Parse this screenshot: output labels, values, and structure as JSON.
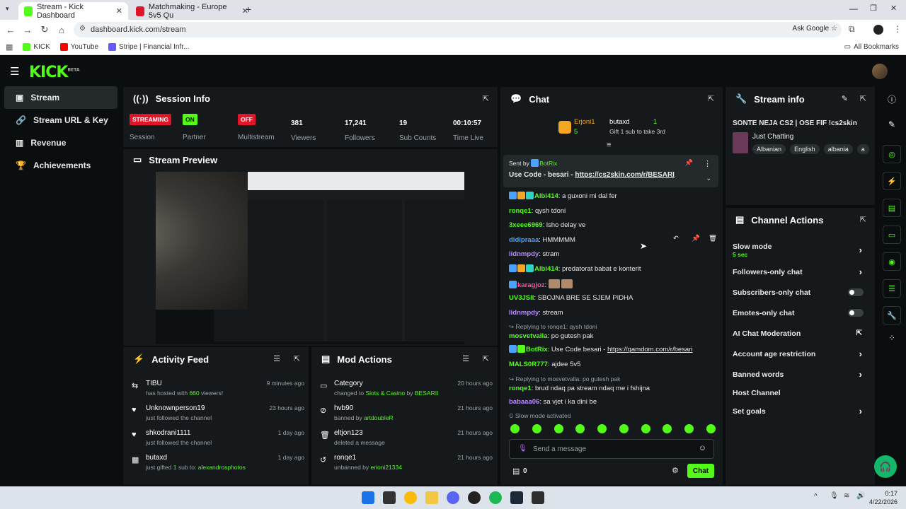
{
  "browser": {
    "tabs": [
      {
        "title": "Stream - Kick Dashboard",
        "active": true
      },
      {
        "title": "Matchmaking - Europe 5v5 Qu",
        "active": false
      }
    ],
    "url": "dashboard.kick.com/stream",
    "ask_google": "Ask Google",
    "bookmarks": [
      "KICK",
      "YouTube",
      "Stripe | Financial Infr..."
    ],
    "all_bookmarks": "All Bookmarks"
  },
  "header": {
    "logo": "KICK",
    "logo_beta": "BETA"
  },
  "sidebar": {
    "items": [
      {
        "label": "Stream",
        "active": true
      },
      {
        "label": "Stream URL & Key"
      },
      {
        "label": "Revenue"
      },
      {
        "label": "Achievements"
      }
    ]
  },
  "session": {
    "title": "Session Info",
    "streaming_badge": "STREAMING",
    "partner_badge": "ON",
    "multistream_badge": "OFF",
    "labels": {
      "session": "Session",
      "partner": "Partner",
      "multistream": "Multistream",
      "viewers": "Viewers",
      "followers": "Followers",
      "subs": "Sub Counts",
      "time": "Time Live"
    },
    "values": {
      "viewers": "381",
      "followers": "17,241",
      "subs": "19",
      "time": "00:10:57"
    }
  },
  "preview": {
    "title": "Stream Preview"
  },
  "activity": {
    "title": "Activity Feed",
    "items": [
      {
        "name": "TIBU",
        "desc_a": "has hosted with ",
        "desc_b": "660",
        "desc_c": " viewers!",
        "time": "9 minutes ago"
      },
      {
        "name": "Unknownperson19",
        "desc_a": "just followed the channel",
        "time": "23 hours ago"
      },
      {
        "name": "shkodrani1111",
        "desc_a": "just followed the channel",
        "time": "1 day ago"
      },
      {
        "name": "butaxd",
        "desc_a": "just gifted ",
        "desc_b": "1",
        "desc_c": " sub to: ",
        "desc_d": "alexandrosphotos",
        "time": "1 day ago"
      }
    ]
  },
  "mod": {
    "title": "Mod Actions",
    "items": [
      {
        "name": "Category",
        "desc_a": "changed to ",
        "desc_b": "Slots & Casino",
        "desc_c": " by ",
        "desc_d": "BESARII",
        "time": "20 hours ago"
      },
      {
        "name": "hvb90",
        "desc_a": "banned by ",
        "desc_b": "artdoubleR",
        "time": "21 hours ago"
      },
      {
        "name": "eltjon123",
        "desc_a": "deleted a message",
        "time": "21 hours ago"
      },
      {
        "name": "ronqe1",
        "desc_a": "unbanned by ",
        "desc_b": "erioni21334",
        "time": "21 hours ago"
      }
    ]
  },
  "chat": {
    "title": "Chat",
    "top_gifter": "Erjoni1",
    "top_gifter_count": "5",
    "gift_user": "butaxd",
    "gift_count": "1",
    "gift_text": "Gift 1 sub to take 3rd",
    "pinned_sent_by": "Sent by",
    "pinned_user": "BotRix",
    "pinned_text": "Use Code - besari - ",
    "pinned_link": "https://cs2skin.com/r/BESARI",
    "messages": [
      {
        "user": "Albi414",
        "text": "a guxoni mi dal fer",
        "color": "#53fc18"
      },
      {
        "user": "ronqe1",
        "text": "qysh tdoni",
        "color": "#53fc18"
      },
      {
        "user": "3xeee6969",
        "text": "lsho delay ve",
        "color": "#53fc18"
      },
      {
        "user": "didipraaa",
        "text": "HMMMMM",
        "color": "#4aa3ff"
      },
      {
        "user": "lidnmpdy",
        "text": "stram",
        "color": "#b58cff"
      },
      {
        "user": "Albi414",
        "text": "predatorat babat e konterit",
        "color": "#53fc18"
      },
      {
        "user": "karagjoz",
        "text": "",
        "color": "#ff4da6"
      },
      {
        "user": "UV3JSII",
        "text": "SBOJNA BRE SE SJEM PIDHA",
        "color": "#53fc18"
      },
      {
        "user": "lidnmpdy",
        "text": "stream",
        "color": "#b58cff"
      },
      {
        "reply": "Replying to ronqe1: qysh tdoni",
        "user": "mosvetvalla",
        "text": "po gutesh pak",
        "color": "#53fc18"
      },
      {
        "user": "BotRix",
        "text": "Use Code besari - ",
        "link": "https://gamdom.com/r/besari",
        "color": "#53fc18"
      },
      {
        "user": "MALS0R777",
        "text": "ajdee 5v5",
        "color": "#53fc18"
      },
      {
        "reply": "Replying to mosvetvalla: po gutesh pak",
        "user": "ronqe1",
        "text": "brud ndaq pa stream ndaq me i fshijna",
        "color": "#53fc18"
      },
      {
        "user": "babaaa06",
        "text": "sa vjet i ka dini be",
        "color": "#b58cff"
      }
    ],
    "slow_mode_notice": "Slow mode activated",
    "input_placeholder": "Send a message",
    "points": "0",
    "send_label": "Chat"
  },
  "stream_info": {
    "title": "Stream info",
    "stream_title": "SONTE NEJA CS2 | OSE FIF !cs2skin",
    "category": "Just Chatting",
    "tags": [
      "Albanian",
      "English",
      "albania",
      "a"
    ]
  },
  "channel_actions": {
    "title": "Channel Actions",
    "rows": [
      {
        "label": "Slow mode",
        "sub": "5 sec",
        "control": "chevron"
      },
      {
        "label": "Followers-only chat",
        "control": "chevron"
      },
      {
        "label": "Subscribers-only chat",
        "control": "toggle"
      },
      {
        "label": "Emotes-only chat",
        "control": "toggle"
      },
      {
        "label": "AI Chat Moderation",
        "control": "external"
      },
      {
        "label": "Account age restriction",
        "control": "chevron"
      },
      {
        "label": "Banned words",
        "control": "chevron"
      },
      {
        "label": "Host Channel",
        "control": "none"
      },
      {
        "label": "Set goals",
        "control": "chevron"
      }
    ]
  },
  "taskbar": {
    "time": "0:17",
    "date": "4/22/2026"
  },
  "colors": {
    "accent": "#53fc18",
    "panel": "#16191b",
    "bg": "#0b0e0f",
    "streaming": "#e0152a"
  }
}
